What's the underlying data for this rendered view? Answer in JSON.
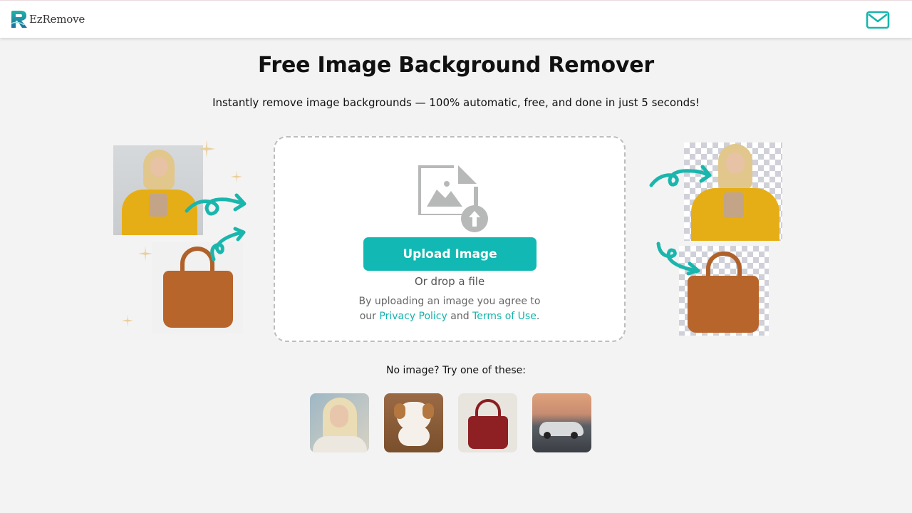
{
  "header": {
    "brand_name": "EzRemove",
    "logo_icon": "ezremove-r-logo-icon",
    "contact_icon": "mail-icon",
    "accent_color": "#12b8b3"
  },
  "hero": {
    "title": "Free Image Background Remover",
    "subtitle": "Instantly remove image backgrounds — 100% automatic, free, and done in just 5 seconds!"
  },
  "upload": {
    "icon": "image-upload-icon",
    "button_label": "Upload Image",
    "drop_text": "Or drop a file",
    "agree_prefix": "By uploading an image you agree to",
    "agree_our": "our",
    "privacy_link": "Privacy Policy",
    "and": "and",
    "terms_link": "Terms of Use",
    "period": "."
  },
  "illustrations": {
    "before": [
      "woman in yellow jacket (original)",
      "brown leather handbag (original)"
    ],
    "after": [
      "woman in yellow jacket (background removed)",
      "brown leather handbag (background removed)"
    ]
  },
  "samples": {
    "label": "No image? Try one of these:",
    "items": [
      {
        "name": "blonde woman portrait"
      },
      {
        "name": "puppy on wooden floor"
      },
      {
        "name": "red leather handbag"
      },
      {
        "name": "silver sports car on track"
      }
    ]
  }
}
